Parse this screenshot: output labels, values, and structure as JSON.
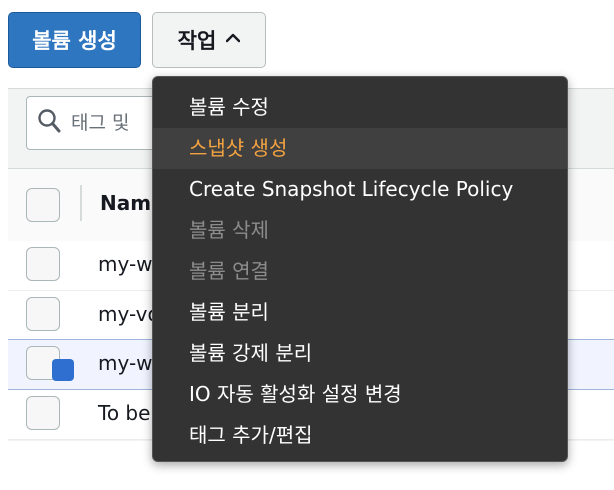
{
  "toolbar": {
    "create_label": "볼륨 생성",
    "actions_label": "작업",
    "actions_chevron": "⌃"
  },
  "search": {
    "placeholder": "태그 및"
  },
  "table": {
    "header": {
      "name_col": "Nam"
    },
    "rows": [
      {
        "name": "my-w",
        "selected": false
      },
      {
        "name": "my-vo",
        "selected": false
      },
      {
        "name": "my-w",
        "selected": true
      },
      {
        "name": "To be",
        "selected": false
      }
    ]
  },
  "menu": {
    "items": [
      {
        "label": "볼륨 수정",
        "state": "enabled"
      },
      {
        "label": "스냅샷 생성",
        "state": "active"
      },
      {
        "label": "Create Snapshot Lifecycle Policy",
        "state": "enabled"
      },
      {
        "label": "볼륨 삭제",
        "state": "disabled"
      },
      {
        "label": "볼륨 연결",
        "state": "disabled"
      },
      {
        "label": "볼륨 분리",
        "state": "enabled"
      },
      {
        "label": "볼륨 강제 분리",
        "state": "enabled"
      },
      {
        "label": "IO 자동 활성화 설정 변경",
        "state": "enabled"
      },
      {
        "label": "태그 추가/편집",
        "state": "enabled"
      }
    ]
  },
  "colors": {
    "primary": "#2f76c1",
    "menu_bg": "#333333",
    "menu_active_text": "#f3a241",
    "menu_disabled_text": "#8c8c8c"
  },
  "icons": {
    "search": "magnifier-icon",
    "actions_chevron": "chevron-up-icon"
  }
}
